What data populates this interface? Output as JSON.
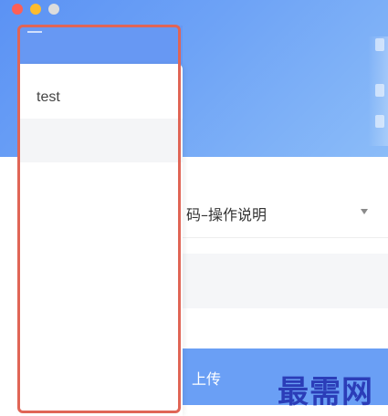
{
  "window": {
    "controls": [
      "close",
      "minimize",
      "maximize"
    ]
  },
  "drawer": {
    "items": [
      {
        "label": "test"
      }
    ]
  },
  "main": {
    "dropdown_text": "码–操作说明",
    "upload_label": "上传"
  },
  "watermark": {
    "text": "最需网"
  },
  "colors": {
    "header_blue": "#5b92f4",
    "button_blue": "#6a9ff5",
    "highlight_red": "#e06556",
    "watermark_blue": "#2b3db8"
  }
}
